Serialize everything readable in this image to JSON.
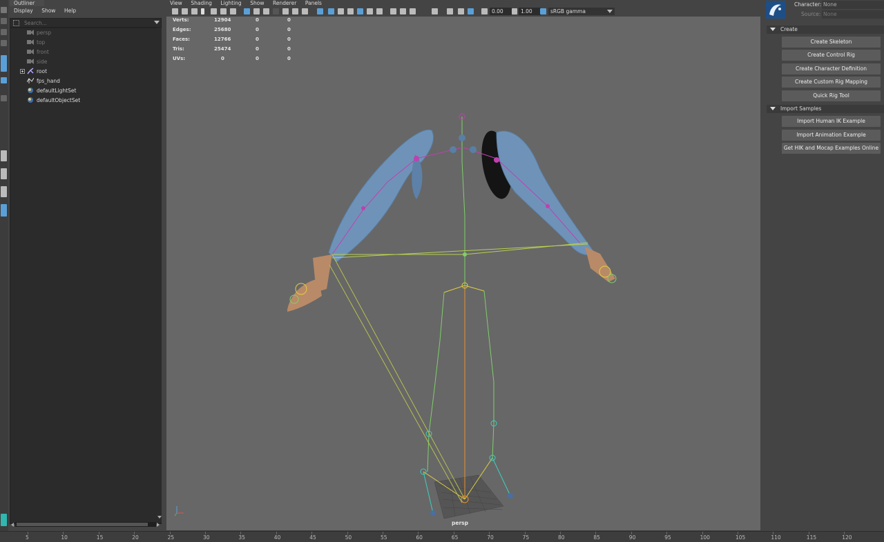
{
  "outliner": {
    "tab_label": "Outliner",
    "menu": [
      "Display",
      "Show",
      "Help"
    ],
    "search_placeholder": "Search...",
    "items": [
      {
        "label": "persp",
        "icon": "camera-icon",
        "dim": true,
        "indent": 0
      },
      {
        "label": "top",
        "icon": "camera-icon",
        "dim": true,
        "indent": 0
      },
      {
        "label": "front",
        "icon": "camera-icon",
        "dim": true,
        "indent": 0
      },
      {
        "label": "side",
        "icon": "camera-icon",
        "dim": true,
        "indent": 0
      },
      {
        "label": "root",
        "icon": "joint-icon",
        "dim": false,
        "expandable": true
      },
      {
        "label": "fps_hand",
        "icon": "mesh-icon",
        "dim": false
      },
      {
        "label": "defaultLightSet",
        "icon": "set-icon",
        "dim": false
      },
      {
        "label": "defaultObjectSet",
        "icon": "set-icon",
        "dim": false
      }
    ]
  },
  "viewport": {
    "menu": [
      "View",
      "Shading",
      "Lighting",
      "Show",
      "Renderer",
      "Panels"
    ],
    "exposure": "0.00",
    "gamma": "1.00",
    "color_space": "sRGB gamma",
    "camera_label": "persp",
    "hud": [
      {
        "label": "Verts:",
        "values": [
          "12904",
          "0",
          "0"
        ]
      },
      {
        "label": "Edges:",
        "values": [
          "25680",
          "0",
          "0"
        ]
      },
      {
        "label": "Faces:",
        "values": [
          "12766",
          "0",
          "0"
        ]
      },
      {
        "label": "Tris:",
        "values": [
          "25474",
          "0",
          "0"
        ]
      },
      {
        "label": "UVs:",
        "values": [
          "0",
          "0",
          "0"
        ]
      }
    ]
  },
  "hik_panel": {
    "character_label": "Character:",
    "character_value": "None",
    "source_label": "Source:",
    "source_value": "None",
    "create_section": "Create",
    "create_buttons": [
      "Create Skeleton",
      "Create Control Rig",
      "Create Character Definition",
      "Create Custom Rig Mapping",
      "Quick Rig Tool"
    ],
    "import_section": "Import Samples",
    "import_buttons": [
      "Import Human IK Example",
      "Import Animation Example",
      "Get HIK and Mocap Examples Online"
    ]
  },
  "timeline": {
    "ticks": [
      5,
      10,
      15,
      20,
      25,
      30,
      35,
      40,
      45,
      50,
      55,
      60,
      65,
      70,
      75,
      80,
      85,
      90,
      95,
      100,
      105,
      110,
      115,
      120
    ]
  },
  "colors": {
    "accent_blue": "#5aa0d8",
    "viewport_bg": "#676767",
    "joint_green": "#7fd06a",
    "joint_cyan": "#3fd0c0",
    "joint_magenta": "#c040b0",
    "joint_yellow": "#e0d040"
  }
}
